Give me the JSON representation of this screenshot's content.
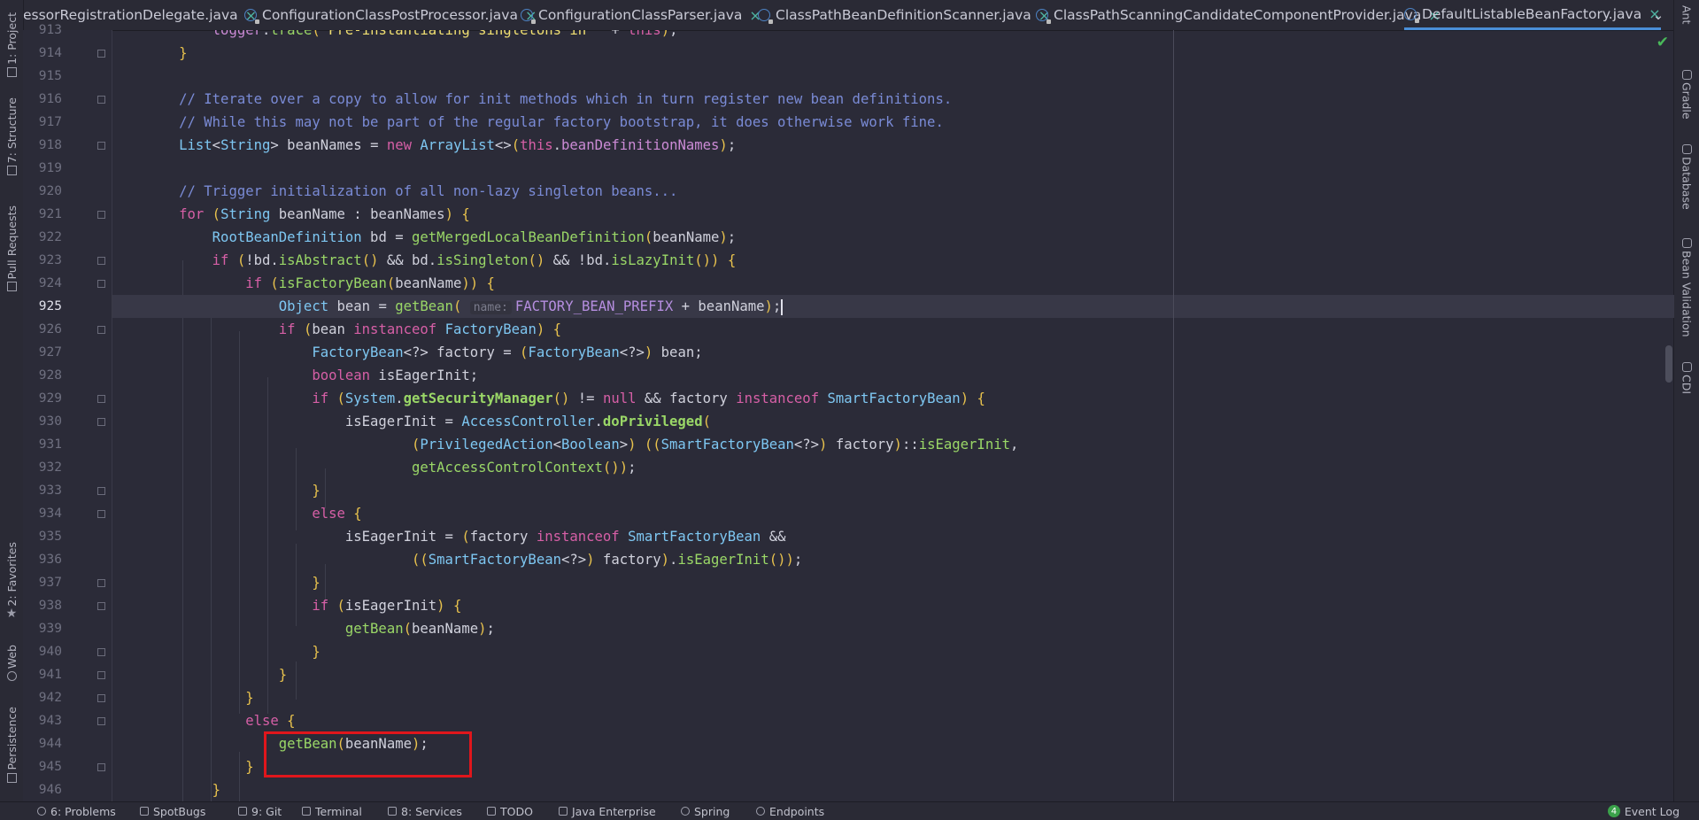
{
  "tabs": [
    {
      "label": "...essorRegistrationDelegate.java",
      "display": "essorRegistrationDelegate.java",
      "active": false
    },
    {
      "label": "ConfigurationClassPostProcessor.java",
      "active": false
    },
    {
      "label": "ConfigurationClassParser.java",
      "active": false
    },
    {
      "label": "ClassPathBeanDefinitionScanner.java",
      "active": false
    },
    {
      "label": "ClassPathScanningCandidateComponentProvider.java",
      "active": false
    },
    {
      "label": "DefaultListableBeanFactory.java",
      "active": true
    }
  ],
  "tab_close_glyph": "×",
  "tab_overflow_glyph": "⌄",
  "left_tools": {
    "project": "1: Project",
    "structure": "7: Structure",
    "pull_requests": "Pull Requests",
    "favorites": "2: Favorites",
    "web": "Web",
    "persistence": "Persistence"
  },
  "right_tools": {
    "ant": "Ant",
    "gradle": "Gradle",
    "database": "Database",
    "bean_validation": "Bean Validation",
    "cdi": "CDI"
  },
  "editor": {
    "current_line": 925,
    "line_numbers": [
      "913",
      "914",
      "915",
      "916",
      "917",
      "918",
      "919",
      "920",
      "921",
      "922",
      "923",
      "924",
      "925",
      "926",
      "927",
      "928",
      "929",
      "930",
      "931",
      "932",
      "933",
      "934",
      "935",
      "936",
      "937",
      "938",
      "939",
      "940",
      "941",
      "942",
      "943",
      "944",
      "945",
      "946"
    ],
    "param_hint": "name:",
    "highlighted_code": "getBean(beanName);"
  },
  "status_bar": {
    "problems": "6: Problems",
    "spotbugs": "SpotBugs",
    "git": "9: Git",
    "terminal": "Terminal",
    "services": "8: Services",
    "todo": "TODO",
    "java_enterprise": "Java Enterprise",
    "spring": "Spring",
    "endpoints": "Endpoints",
    "event_log": "Event Log",
    "event_count": "4"
  },
  "colors": {
    "keyword": "#d65fa6",
    "type": "#7ec7f2",
    "method": "#9ad767",
    "comment": "#7a8bd6",
    "string": "#f1e072",
    "highlight_box": "#e0161c",
    "check": "#49b85a"
  }
}
